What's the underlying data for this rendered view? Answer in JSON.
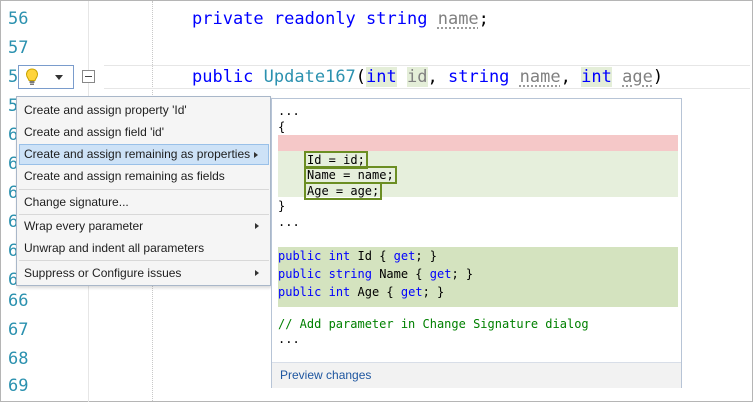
{
  "editor": {
    "line_numbers": [
      "56",
      "57",
      "5",
      "5",
      "6",
      "6",
      "6",
      "6",
      "6",
      "6",
      "66",
      "67",
      "68",
      "69"
    ],
    "line_56": {
      "kw1": "private",
      "kw2": "readonly",
      "kw3": "string",
      "field": "name",
      "end": ";"
    },
    "line_58": {
      "kw": "public",
      "type": "Update167",
      "paren_open": "(",
      "p1_type": "int",
      "p1_name": "id",
      "comma1": ",",
      "p2_type": "string",
      "p2_name": "name",
      "comma2": ",",
      "p3_type": "int",
      "p3_name": "age",
      "paren_close": ")"
    }
  },
  "menu": {
    "items": [
      {
        "label": "Create and assign property 'Id'"
      },
      {
        "label": "Create and assign field 'id'"
      },
      {
        "label": "Create and assign remaining as properties"
      },
      {
        "label": "Create and assign remaining as fields"
      },
      {
        "label": "Change signature..."
      },
      {
        "label": "Wrap every parameter"
      },
      {
        "label": "Unwrap and indent all parameters"
      },
      {
        "label": "Suppress or Configure issues"
      }
    ]
  },
  "preview": {
    "line1": "...",
    "line2": "{",
    "assign1": "Id = id;",
    "assign2": "Name = name;",
    "assign3": "Age = age;",
    "close": "}",
    "dots2": "...",
    "prop1_a": "public",
    "prop1_b": "int",
    "prop1_c": "Id { ",
    "prop1_d": "get",
    "prop1_e": "; }",
    "prop2_a": "public",
    "prop2_b": "string",
    "prop2_c": "Name { ",
    "prop2_d": "get",
    "prop2_e": "; }",
    "prop3_a": "public",
    "prop3_b": "int",
    "prop3_c": "Age { ",
    "prop3_d": "get",
    "prop3_e": "; }",
    "comment": "// Add parameter in Change Signature dialog",
    "dots3": "...",
    "footer_link": "Preview changes"
  },
  "colors": {
    "keyword": "#0000ff",
    "type": "#2b91af",
    "line_number": "#2b91af",
    "comment": "#008000",
    "removed": "#f5c8c8",
    "added": "#d4e3bf"
  }
}
